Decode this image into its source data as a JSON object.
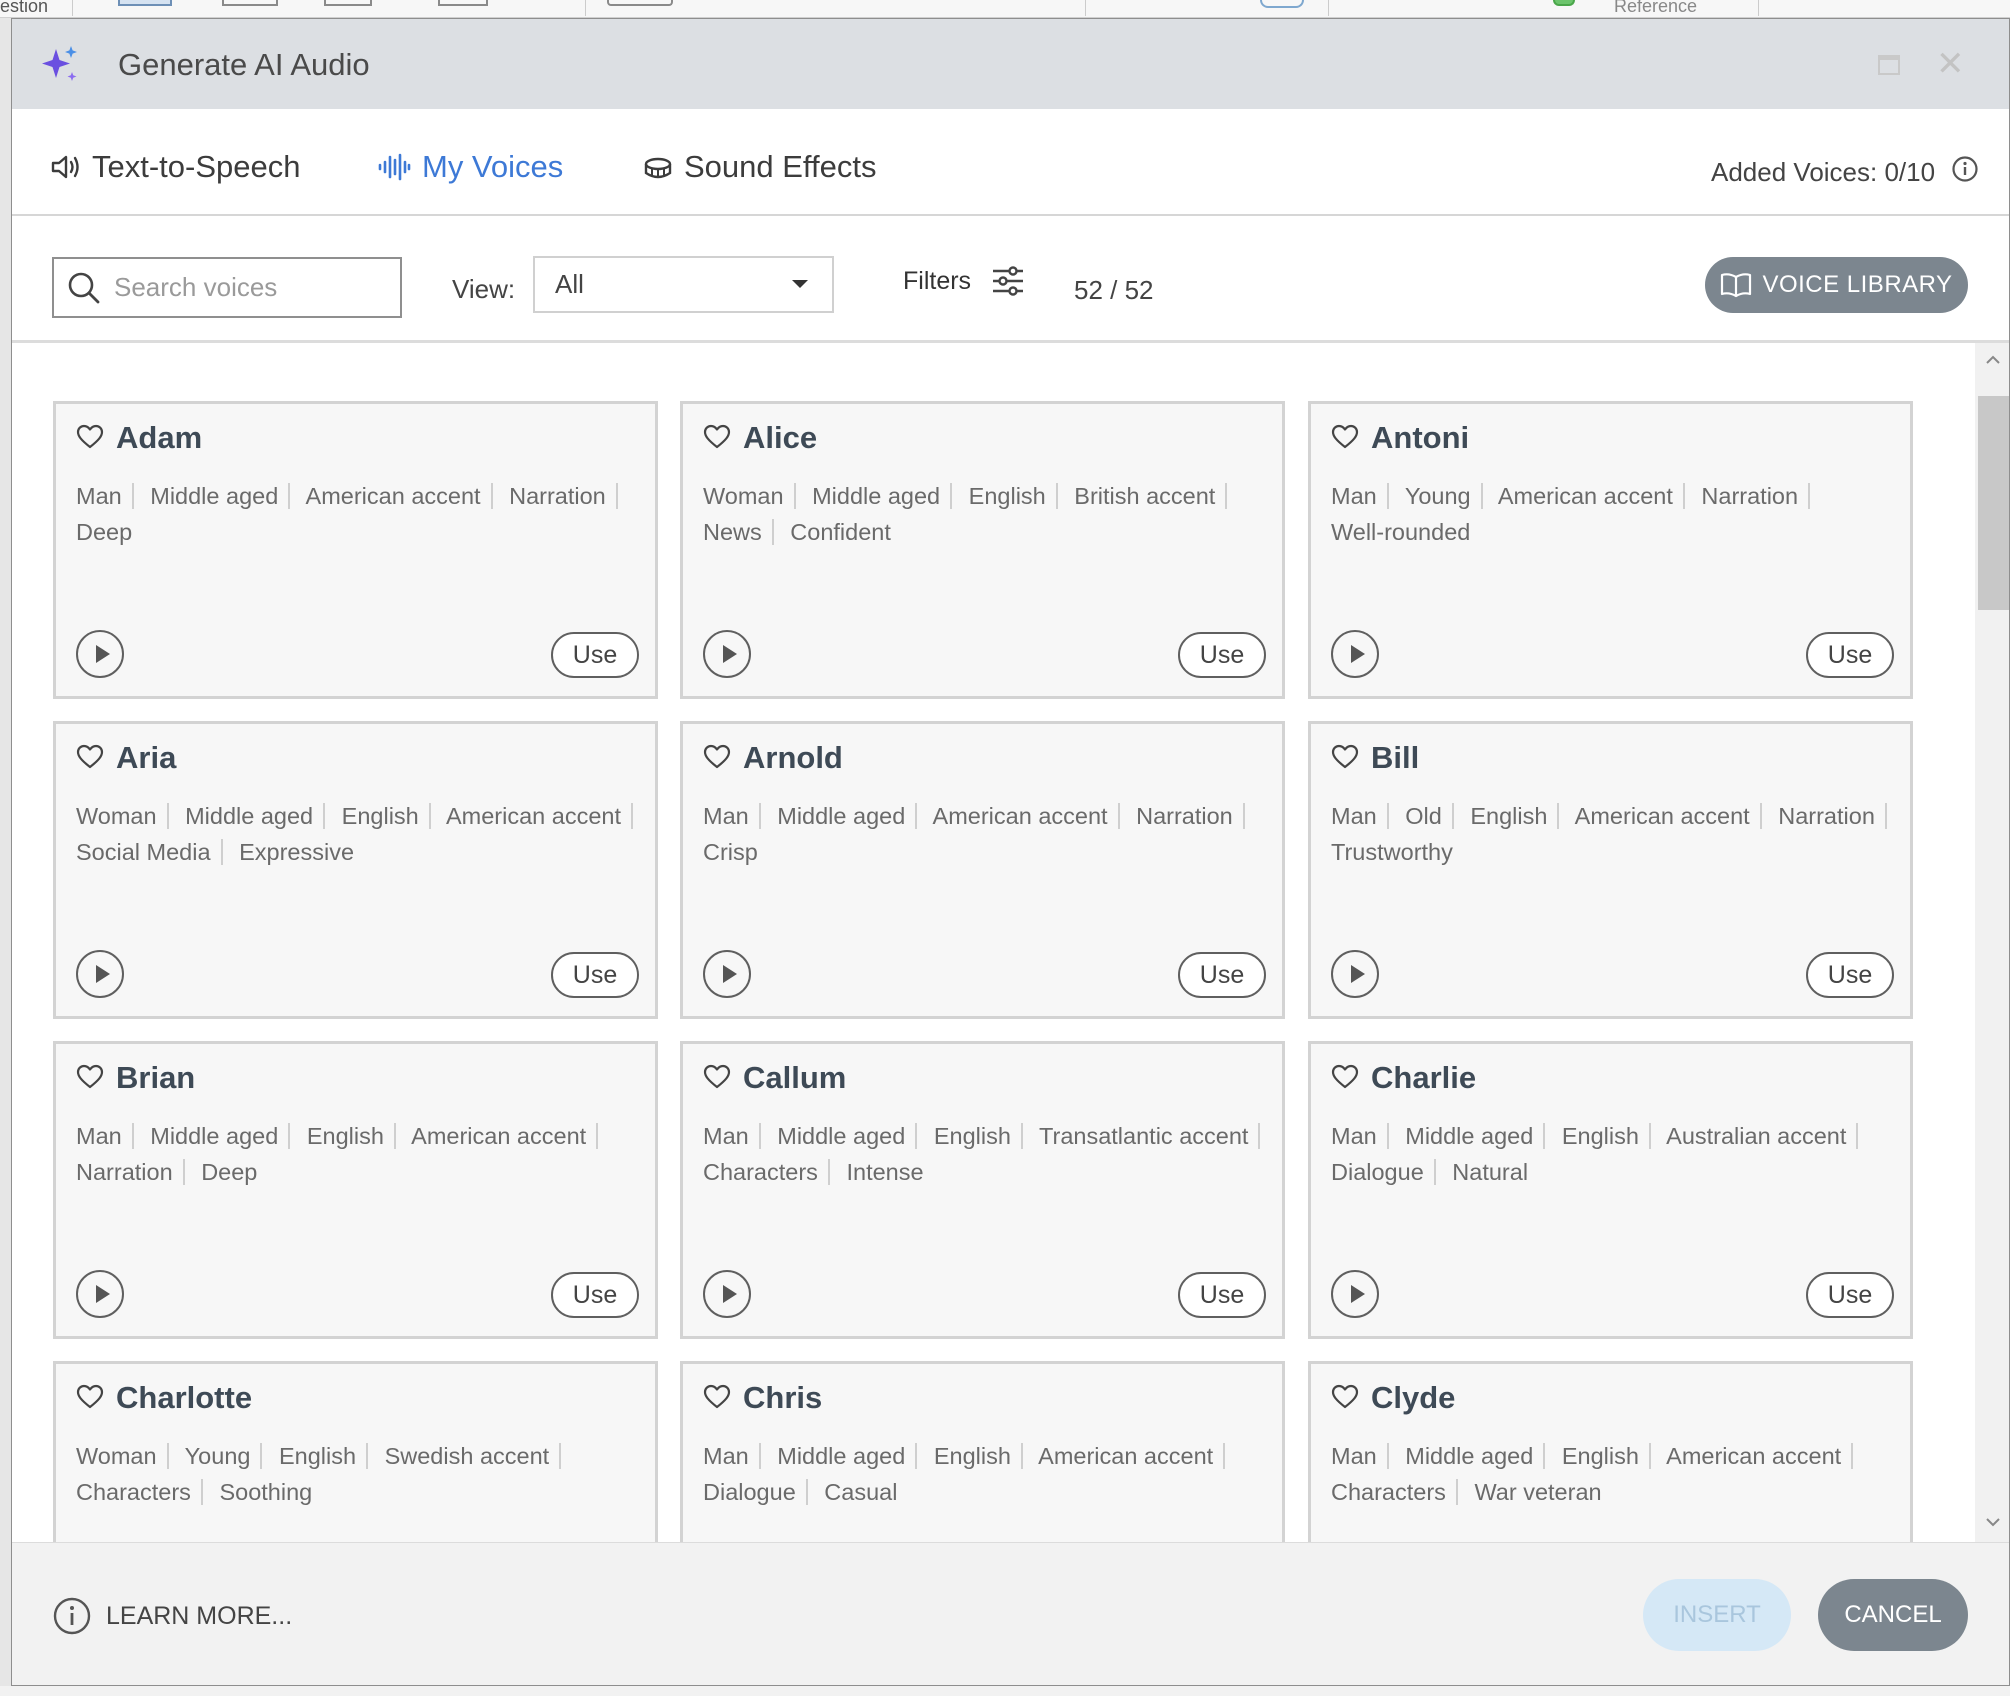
{
  "background": {
    "toolbar_texts": [
      "estion",
      "Reference"
    ]
  },
  "dialog": {
    "title": "Generate AI Audio",
    "tabs": [
      {
        "label": "Text-to-Speech",
        "icon": "speaker-icon"
      },
      {
        "label": "My Voices",
        "icon": "waveform-icon",
        "active": true
      },
      {
        "label": "Sound Effects",
        "icon": "drum-icon"
      }
    ],
    "added_voices": "Added Voices: 0/10",
    "search": {
      "placeholder": "Search voices",
      "value": ""
    },
    "view": {
      "label": "View:",
      "selected": "All"
    },
    "filters_label": "Filters",
    "count": "52 / 52",
    "voice_library_label": "VOICE LIBRARY",
    "learn_more": "LEARN MORE...",
    "insert_label": "INSERT",
    "cancel_label": "CANCEL",
    "use_label": "Use",
    "accent_color": "#3d79d6",
    "voices": [
      {
        "name": "Adam",
        "tags": [
          "Man",
          "Middle aged",
          "American accent",
          "Narration",
          "Deep"
        ]
      },
      {
        "name": "Alice",
        "tags": [
          "Woman",
          "Middle aged",
          "English",
          "British accent",
          "News",
          "Confident"
        ]
      },
      {
        "name": "Antoni",
        "tags": [
          "Man",
          "Young",
          "American accent",
          "Narration",
          "Well-rounded"
        ]
      },
      {
        "name": "Aria",
        "tags": [
          "Woman",
          "Middle aged",
          "English",
          "American accent",
          "Social Media",
          "Expressive"
        ]
      },
      {
        "name": "Arnold",
        "tags": [
          "Man",
          "Middle aged",
          "American accent",
          "Narration",
          "Crisp"
        ]
      },
      {
        "name": "Bill",
        "tags": [
          "Man",
          "Old",
          "English",
          "American accent",
          "Narration",
          "Trustworthy"
        ]
      },
      {
        "name": "Brian",
        "tags": [
          "Man",
          "Middle aged",
          "English",
          "American accent",
          "Narration",
          "Deep"
        ]
      },
      {
        "name": "Callum",
        "tags": [
          "Man",
          "Middle aged",
          "English",
          "Transatlantic accent",
          "Characters",
          "Intense"
        ]
      },
      {
        "name": "Charlie",
        "tags": [
          "Man",
          "Middle aged",
          "English",
          "Australian accent",
          "Dialogue",
          "Natural"
        ]
      },
      {
        "name": "Charlotte",
        "tags": [
          "Woman",
          "Young",
          "English",
          "Swedish accent",
          "Characters",
          "Soothing"
        ]
      },
      {
        "name": "Chris",
        "tags": [
          "Man",
          "Middle aged",
          "English",
          "American accent",
          "Dialogue",
          "Casual"
        ]
      },
      {
        "name": "Clyde",
        "tags": [
          "Man",
          "Middle aged",
          "English",
          "American accent",
          "Characters",
          "War veteran"
        ]
      }
    ]
  }
}
